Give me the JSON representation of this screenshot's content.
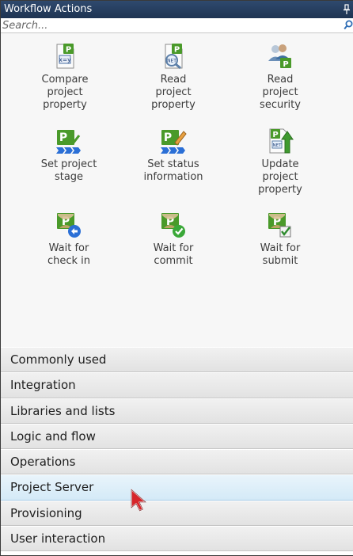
{
  "panel": {
    "title": "Workflow Actions",
    "pin_icon": "pin-icon"
  },
  "search": {
    "placeholder": "Search...",
    "icon": "search-icon"
  },
  "actions": [
    {
      "label": "Compare\nproject\nproperty",
      "icon": "compare-project-property-icon"
    },
    {
      "label": "Read\nproject\nproperty",
      "icon": "read-project-property-icon"
    },
    {
      "label": "Read\nproject\nsecurity",
      "icon": "read-project-security-icon"
    },
    {
      "label": "Set project\nstage",
      "icon": "set-project-stage-icon"
    },
    {
      "label": "Set status\ninformation",
      "icon": "set-status-information-icon"
    },
    {
      "label": "Update\nproject\nproperty",
      "icon": "update-project-property-icon"
    },
    {
      "label": "Wait for\ncheck in",
      "icon": "wait-for-check-in-icon"
    },
    {
      "label": "Wait for\ncommit",
      "icon": "wait-for-commit-icon"
    },
    {
      "label": "Wait for\nsubmit",
      "icon": "wait-for-submit-icon"
    }
  ],
  "categories": [
    {
      "label": "Commonly used",
      "selected": false
    },
    {
      "label": "Integration",
      "selected": false
    },
    {
      "label": "Libraries and lists",
      "selected": false
    },
    {
      "label": "Logic and flow",
      "selected": false
    },
    {
      "label": "Operations",
      "selected": false
    },
    {
      "label": "Project Server",
      "selected": true
    },
    {
      "label": "Provisioning",
      "selected": false
    },
    {
      "label": "User interaction",
      "selected": false
    }
  ],
  "colors": {
    "titlebar": "#1e3452",
    "project_green": "#4a9a2a",
    "selected_row": "#d4eaf7"
  }
}
